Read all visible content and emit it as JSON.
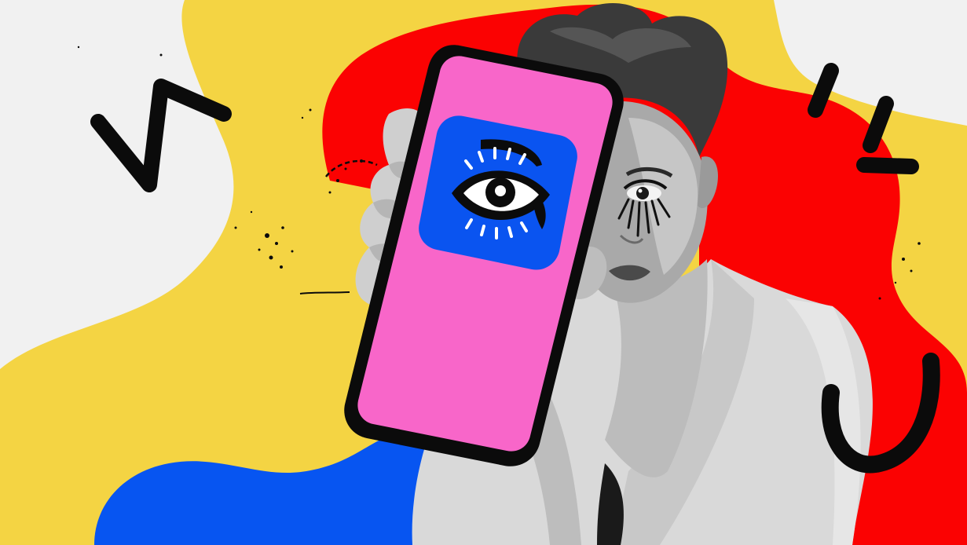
{
  "scene": {
    "colors": {
      "background": "#f1f1f1",
      "yellow_blob": "#f4d443",
      "red_blob": "#fb0202",
      "blue_blob": "#0755f1",
      "phone_screen": "#f866c9",
      "phone_frame": "#0b0b0b",
      "app_icon": "#0a54f0",
      "ink": "#0b0b0b"
    },
    "icons": [
      "eye-icon"
    ]
  }
}
